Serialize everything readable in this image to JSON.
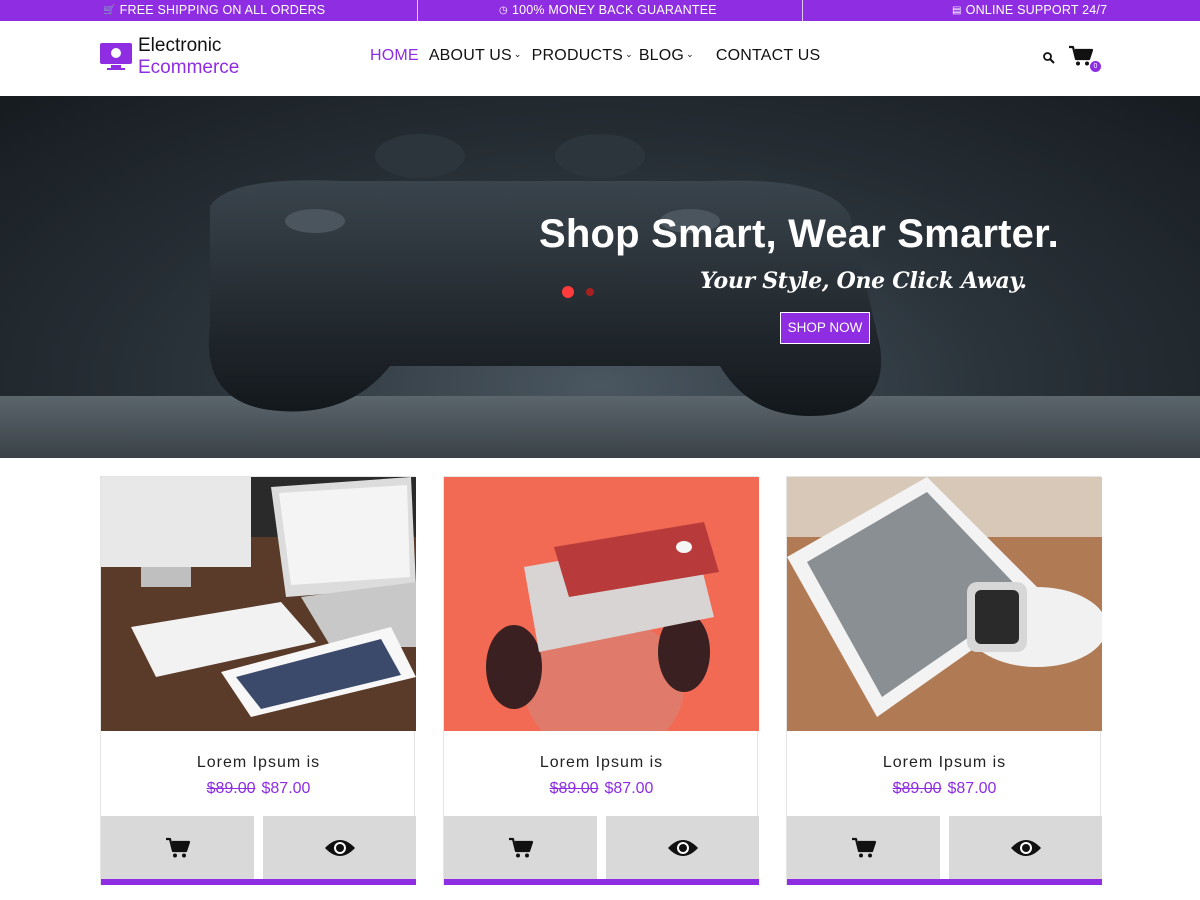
{
  "topbar": {
    "shipping": "FREE SHIPPING ON ALL ORDERS",
    "guarantee": "100% MONEY BACK GUARANTEE",
    "support": "ONLINE SUPPORT 24/7"
  },
  "logo": {
    "line1": "Electronic",
    "line2": "Ecommerce"
  },
  "nav": {
    "items": [
      {
        "label": "HOME",
        "active": true,
        "dropdown": false
      },
      {
        "label": "ABOUT US",
        "active": false,
        "dropdown": true
      },
      {
        "label": "PRODUCTS",
        "active": false,
        "dropdown": true
      },
      {
        "label": "BLOG",
        "active": false,
        "dropdown": true
      },
      {
        "label": "CONTACT US",
        "active": false,
        "dropdown": false
      }
    ]
  },
  "cart": {
    "count": "0"
  },
  "hero": {
    "title": "Shop Smart, Wear Smarter.",
    "subtitle": "Your Style, One Click Away.",
    "button": "SHOP NOW"
  },
  "products": [
    {
      "name": "Lorem Ipsum is",
      "old_price": "$89.00",
      "price": "$87.00",
      "image": "desk-imac-laptop-tablet"
    },
    {
      "name": "Lorem Ipsum is",
      "old_price": "$89.00",
      "price": "$87.00",
      "image": "vr-headset-person"
    },
    {
      "name": "Lorem Ipsum is",
      "old_price": "$89.00",
      "price": "$87.00",
      "image": "phone-smartwatch"
    }
  ],
  "colors": {
    "accent": "#8e2de2",
    "button_bg": "#d9d9d9"
  },
  "icons": [
    "cart-icon",
    "clock-icon",
    "support-icon",
    "search-icon",
    "eye-icon",
    "logo-monitor-icon"
  ]
}
